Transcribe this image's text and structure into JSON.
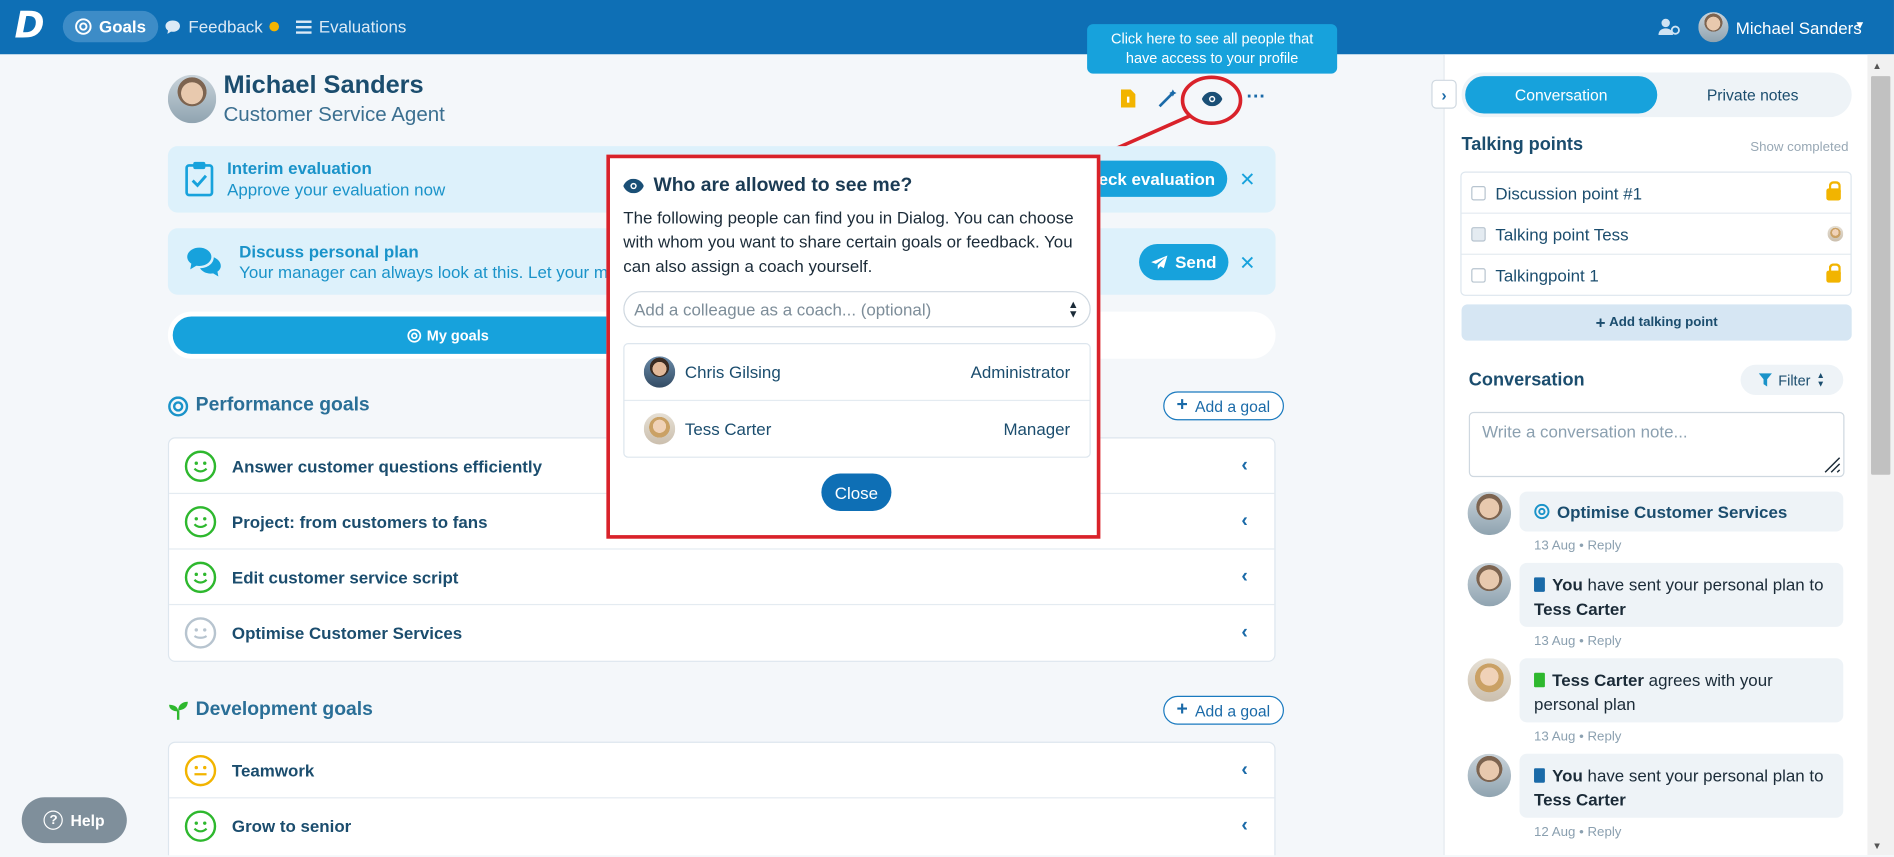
{
  "topbar": {
    "logo": "D",
    "nav": [
      {
        "label": "Goals"
      },
      {
        "label": "Feedback"
      },
      {
        "label": "Evaluations"
      }
    ],
    "user_name": "Michael Sanders"
  },
  "tooltip": "Click here to see all people that have access to your profile",
  "profile": {
    "name": "Michael Sanders",
    "role": "Customer Service Agent"
  },
  "interim": {
    "title": "Interim evaluation",
    "subtitle": "Approve your evaluation now",
    "button": "heck evaluation"
  },
  "plan": {
    "title": "Discuss personal plan",
    "subtitle": "Your manager can always look at this. Let your m",
    "button": "Send"
  },
  "tabs": {
    "my_goals": "My goals"
  },
  "performance": {
    "title": "Performance goals",
    "add": "Add a goal",
    "goals": [
      {
        "label": "Answer customer questions efficiently",
        "mood": "happy"
      },
      {
        "label": "Project: from customers to fans",
        "mood": "happy"
      },
      {
        "label": "Edit customer service script",
        "mood": "happy"
      },
      {
        "label": "Optimise Customer Services",
        "mood": "neutral-gray"
      }
    ]
  },
  "development": {
    "title": "Development goals",
    "add": "Add a goal",
    "goals": [
      {
        "label": "Teamwork",
        "mood": "neutral-yellow"
      },
      {
        "label": "Grow to senior",
        "mood": "happy"
      }
    ]
  },
  "help": "Help",
  "modal": {
    "title": "Who are allowed to see me?",
    "body": "The following people can find you in Dialog. You can choose with whom you want to share certain goals or feedback. You can also assign a coach yourself.",
    "select_placeholder": "Add a colleague as a coach... (optional)",
    "people": [
      {
        "name": "Chris Gilsing",
        "role": "Administrator"
      },
      {
        "name": "Tess Carter",
        "role": "Manager"
      }
    ],
    "close": "Close"
  },
  "sidebar": {
    "tabs": [
      "Conversation",
      "Private notes"
    ],
    "talking_points_title": "Talking points",
    "show_completed": "Show completed",
    "talking_points": [
      {
        "label": "Discussion point #1",
        "marker": "lock"
      },
      {
        "label": "Talking point Tess",
        "marker": "avatar"
      },
      {
        "label": "Talkingpoint 1",
        "marker": "lock"
      }
    ],
    "add_talking_point": "Add talking point",
    "conversation_title": "Conversation",
    "filter": "Filter",
    "note_placeholder": "Write a conversation note...",
    "feed": [
      {
        "mention": "Optimise Customer Services",
        "date": "13 Aug",
        "reply": "Reply"
      },
      {
        "bold1": "You",
        "text": " have sent your personal plan to ",
        "bold2": "Tess Carter",
        "date": "13 Aug",
        "reply": "Reply"
      },
      {
        "bold1": "Tess Carter",
        "text": " agrees with your personal plan",
        "date": "13 Aug",
        "reply": "Reply"
      },
      {
        "bold1": "You",
        "text": " have sent your personal plan to ",
        "bold2": "Tess Carter",
        "date": "12 Aug",
        "reply": "Reply"
      }
    ]
  },
  "colors": {
    "primary": "#0e6fb5",
    "accent": "#17a2dc",
    "highlight": "#d9222a"
  }
}
